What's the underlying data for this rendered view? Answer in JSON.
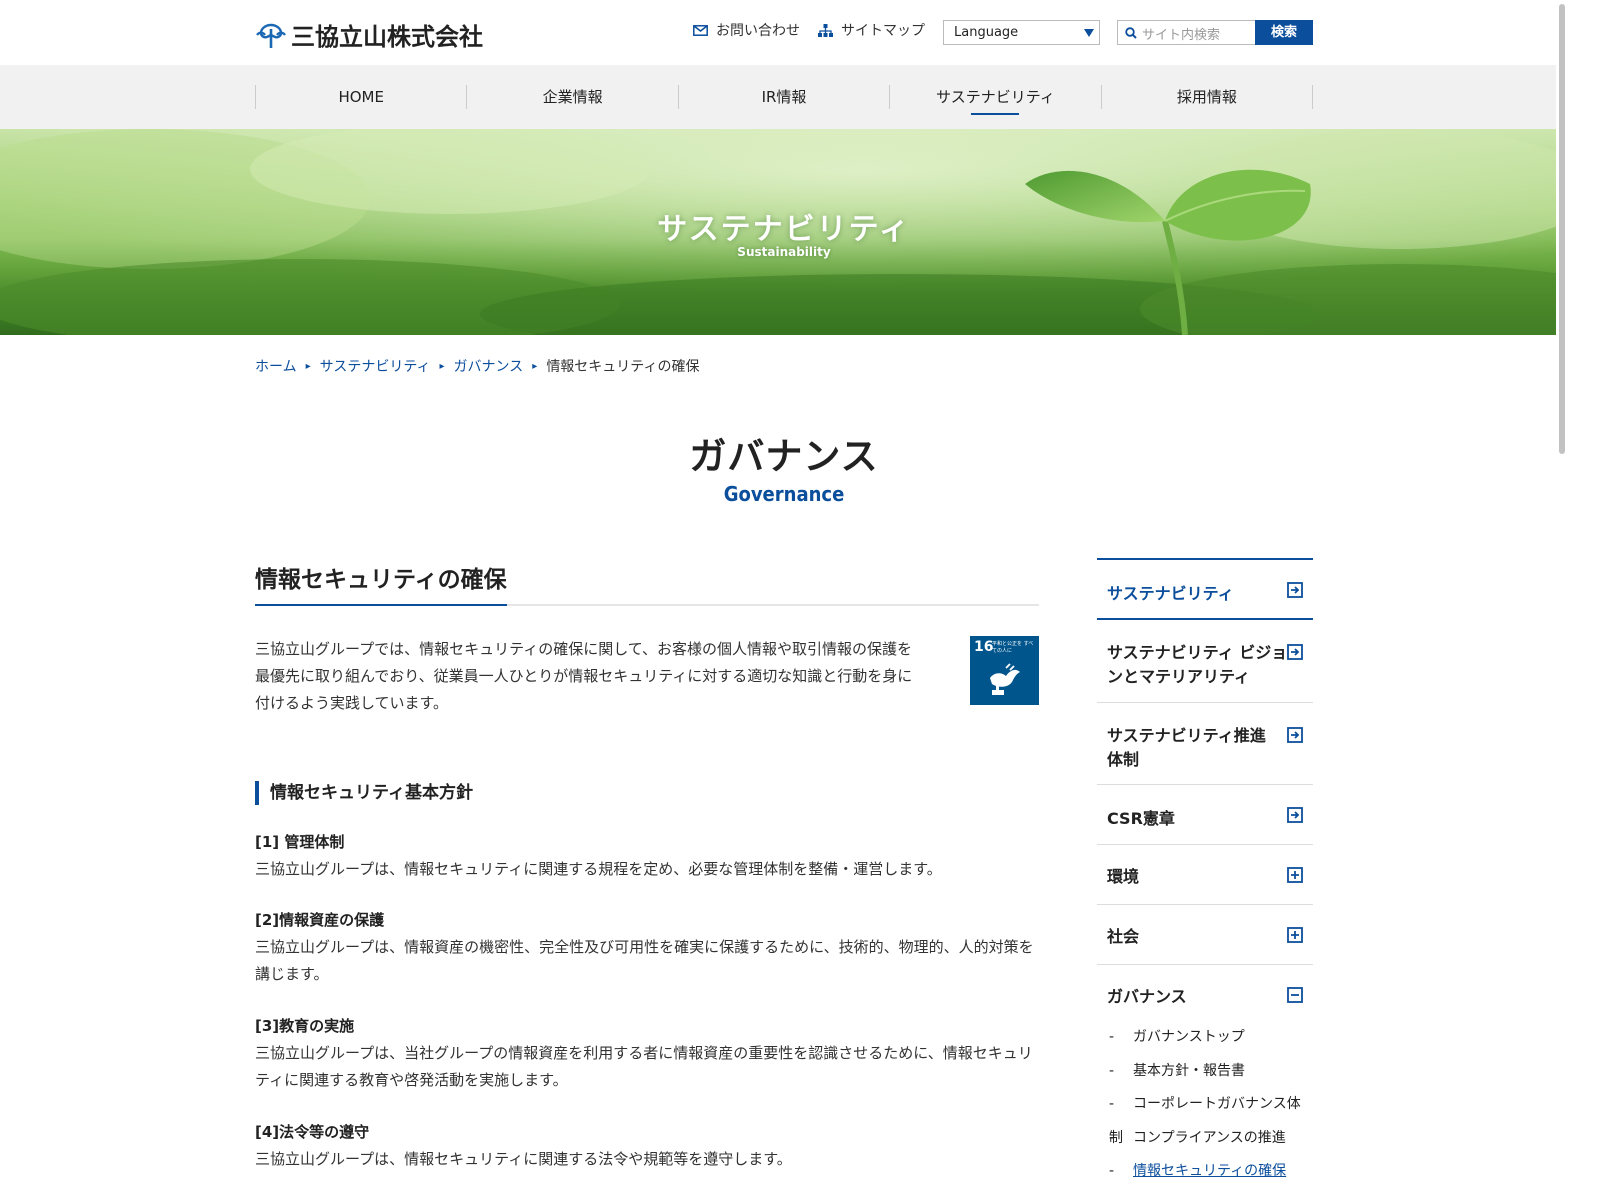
{
  "header": {
    "logo_text": "三協立山株式会社",
    "contact_label": "お問い合わせ",
    "sitemap_label": "サイトマップ",
    "language_selected": "Language",
    "search_placeholder": "サイト内検索",
    "search_button": "検索"
  },
  "gnav": {
    "items": [
      "HOME",
      "企業情報",
      "IR情報",
      "サステナビリティ",
      "採用情報"
    ]
  },
  "hero": {
    "title": "サステナビリティ",
    "subtitle": "Sustainability"
  },
  "breadcrumb": {
    "items": [
      "ホーム",
      "サステナビリティ",
      "ガバナンス"
    ],
    "current": "情報セキュリティの確保"
  },
  "page": {
    "title": "ガバナンス",
    "subtitle": "Governance"
  },
  "main": {
    "heading": "情報セキュリティの確保",
    "intro": "三協立山グループでは、情報セキュリティの確保に関して、お客様の個人情報や取引情報の保護を最優先に取り組んでおり、従業員一人ひとりが情報セキュリティに対する適切な知識と行動を身に付けるよう実践しています。",
    "sdg_number": "16",
    "sdg_text": "平和と公正を すべての人に",
    "policy_heading": "情報セキュリティ基本方針",
    "policies": [
      {
        "title": "[1] 管理体制",
        "body": "三協立山グループは、情報セキュリティに関連する規程を定め、必要な管理体制を整備・運営します。"
      },
      {
        "title": "[2]情報資産の保護",
        "body": "三協立山グループは、情報資産の機密性、完全性及び可用性を確実に保護するために、技術的、物理的、人的対策を講じます。"
      },
      {
        "title": "[3]教育の実施",
        "body": "三協立山グループは、当社グループの情報資産を利用する者に情報資産の重要性を認識させるために、情報セキュリティに関連する教育や啓発活動を実施します。"
      },
      {
        "title": "[4]法令等の遵守",
        "body": "三協立山グループは、情報セキュリティに関連する法令や規範等を遵守します。"
      }
    ]
  },
  "side": {
    "items": [
      {
        "label": "サステナビリティ",
        "icon": "arrow-box-icon"
      },
      {
        "label": "サステナビリティ ビジョンとマテリアリティ",
        "icon": "arrow-box-icon"
      },
      {
        "label": "サステナビリティ推進 体制",
        "icon": "arrow-box-icon"
      },
      {
        "label": "CSR憲章",
        "icon": "arrow-box-icon"
      },
      {
        "label": "環境",
        "icon": "plus-box-icon"
      },
      {
        "label": "社会",
        "icon": "plus-box-icon"
      },
      {
        "label": "ガバナンス",
        "icon": "minus-box-icon"
      }
    ],
    "sub_items": [
      "ガバナンストップ",
      "基本方針・報告書",
      "コーポレートガバナンス体制",
      "コンプライアンスの推進",
      "情報セキュリティの確保"
    ],
    "sub_dash": "-"
  },
  "colors": {
    "accent": "#0b4e9c",
    "nav_bg": "#f1f1f1"
  }
}
